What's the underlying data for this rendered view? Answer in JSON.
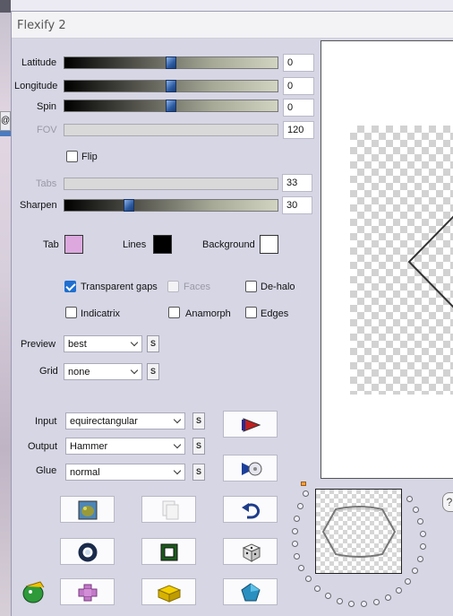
{
  "window": {
    "title": "Flexify 2"
  },
  "background": {
    "tab_text": "@"
  },
  "sliders": [
    {
      "label": "Latitude",
      "value": "0",
      "fraction": 0.5,
      "enabled": true
    },
    {
      "label": "Longitude",
      "value": "0",
      "fraction": 0.5,
      "enabled": true
    },
    {
      "label": "Spin",
      "value": "0",
      "fraction": 0.5,
      "enabled": true
    },
    {
      "label": "FOV",
      "value": "120",
      "enabled": false
    },
    {
      "label": "Tabs",
      "value": "33",
      "enabled": false
    },
    {
      "label": "Sharpen",
      "value": "30",
      "fraction": 0.3,
      "enabled": true
    }
  ],
  "flip": {
    "label": "Flip",
    "checked": false
  },
  "colors": {
    "tab": {
      "label": "Tab",
      "value": "#dca8de"
    },
    "lines": {
      "label": "Lines",
      "value": "#000000"
    },
    "background": {
      "label": "Background",
      "value": "#ffffff"
    }
  },
  "options": {
    "transparent_gaps": {
      "label": "Transparent gaps",
      "checked": true
    },
    "faces": {
      "label": "Faces",
      "checked": false,
      "enabled": false
    },
    "de_halo": {
      "label": "De-halo",
      "checked": false
    },
    "indicatrix": {
      "label": "Indicatrix",
      "checked": false
    },
    "anamorph": {
      "label": "Anamorph",
      "checked": false
    },
    "edges": {
      "label": "Edges",
      "checked": false
    }
  },
  "preview_select": {
    "label": "Preview",
    "value": "best",
    "s_label": "S"
  },
  "grid_select": {
    "label": "Grid",
    "value": "none",
    "s_label": "S"
  },
  "input_select": {
    "label": "Input",
    "value": "equirectangular",
    "s_label": "S"
  },
  "output_select": {
    "label": "Output",
    "value": "Hammer",
    "s_label": "S"
  },
  "glue_select": {
    "label": "Glue",
    "value": "normal",
    "s_label": "S"
  },
  "help": {
    "label": "?"
  },
  "accent_color": "#1f6fd0"
}
